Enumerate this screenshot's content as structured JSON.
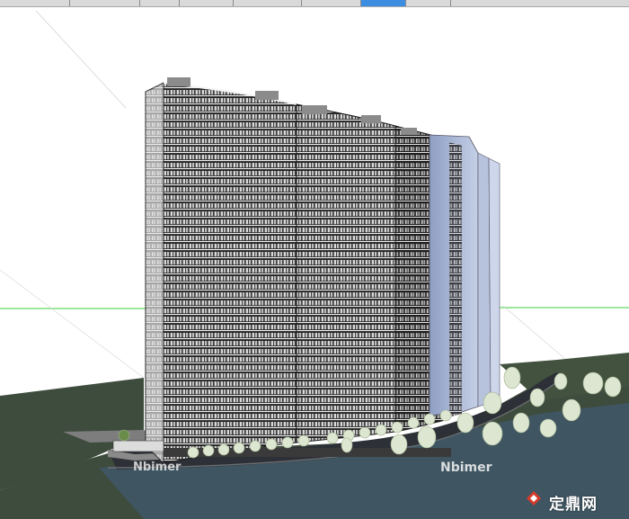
{
  "tabs": [
    {
      "label": "",
      "active": false
    },
    {
      "label": "",
      "active": false
    },
    {
      "label": "",
      "active": false
    },
    {
      "label": "",
      "active": false
    },
    {
      "label": "",
      "active": false
    },
    {
      "label": "",
      "active": false
    },
    {
      "label": "",
      "active": false
    },
    {
      "label": "",
      "active": false
    },
    {
      "label": "",
      "active": true
    },
    {
      "label": "",
      "active": false
    }
  ],
  "watermarks": {
    "left": "Nbimer",
    "right": "Nbimer",
    "brand": "定鼎网",
    "brand_logo": "dingding-logo"
  },
  "colors": {
    "sky": "#ffffff",
    "ground": "#3e4c3d",
    "water": "#3f5662",
    "road": "#2d3036",
    "facade": "#262626",
    "glass": "#a9b7d6",
    "axis_green": "#3ad23a",
    "trees": "#dce6d0",
    "active_tab": "#3d8ee0"
  }
}
